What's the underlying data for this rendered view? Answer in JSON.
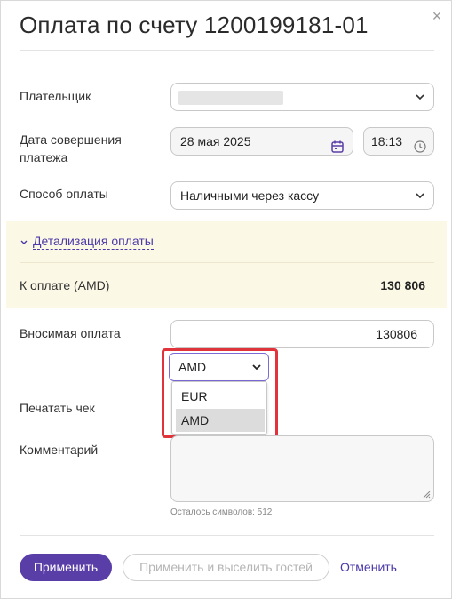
{
  "dialog": {
    "title": "Оплата по счету 1200199181-01",
    "close_icon": "close-icon"
  },
  "form": {
    "payer": {
      "label": "Плательщик",
      "value": ""
    },
    "date": {
      "label_line1": "Дата совершения",
      "label_line2": "платежа",
      "value": "28 мая 2025",
      "time": "18:13"
    },
    "method": {
      "label": "Способ оплаты",
      "value": "Наличными через кассу"
    },
    "details_link": "Детализация оплаты",
    "amount_due": {
      "label": "К оплате (AMD)",
      "value": "130 806"
    },
    "payment": {
      "label": "Вносимая оплата",
      "value": "130806",
      "currency": "AMD",
      "currency_options": [
        "EUR",
        "AMD"
      ],
      "selected_currency": "AMD"
    },
    "print_receipt": {
      "label": "Печатать чек"
    },
    "comment": {
      "label": "Комментарий",
      "value": "",
      "counter": "Осталось символов: 512"
    }
  },
  "actions": {
    "apply": "Применить",
    "apply_and_checkout": "Применить и выселить гостей",
    "cancel": "Отменить"
  },
  "colors": {
    "accent": "#5a3ea8",
    "link": "#4b3aa8",
    "highlight": "#e0333c",
    "band": "#fcf8e6"
  }
}
